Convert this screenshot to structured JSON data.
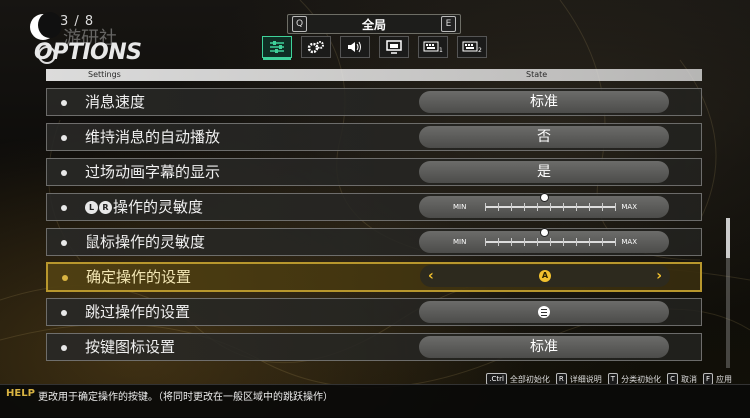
{
  "page_indicator": "3 / 8",
  "title": "OPTIONS",
  "watermark": "游研社",
  "tabs": {
    "key_left": "Q",
    "key_right": "E",
    "current": "全局",
    "icons": [
      "sliders-icon",
      "gears-icon",
      "speaker-icon",
      "monitor-icon",
      "keyboard-1-icon",
      "keyboard-2-icon"
    ],
    "keyboard_1_sub": "1",
    "keyboard_2_sub": "2"
  },
  "header": {
    "settings": "Settings",
    "state": "State"
  },
  "rows": [
    {
      "label": "消息速度",
      "value": "标准"
    },
    {
      "label": "维持消息的自动播放",
      "value": "否"
    },
    {
      "label": "过场动画字幕的显示",
      "value": "是"
    },
    {
      "label_prefix_icons": [
        "L",
        "R"
      ],
      "label": "操作的灵敏度",
      "min": "MIN",
      "max": "MAX",
      "level": 0.45
    },
    {
      "label": "鼠标操作的灵敏度",
      "min": "MIN",
      "max": "MAX",
      "level": 0.45
    },
    {
      "label": "确定操作的设置",
      "value_icon": "A"
    },
    {
      "label": "跳过操作的设置",
      "value_icon": "menu-button-icon"
    },
    {
      "label": "按键图标设置",
      "value": "标准"
    }
  ],
  "help": {
    "label": "HELP",
    "text": "更改用于确定操作的按键。（将同时更改在一般区域中的跳跃操作）"
  },
  "shortcuts": [
    {
      "key": ".Ctrl",
      "label": "全部初始化"
    },
    {
      "key": "R",
      "label": "详细说明"
    },
    {
      "key": "T",
      "label": "分类初始化"
    },
    {
      "key": "C",
      "label": "取消"
    },
    {
      "key": "F",
      "label": "应用"
    }
  ],
  "colors": {
    "accent": "#3fd29a",
    "selected": "#d9b442",
    "arrow": "#f2c12e"
  }
}
